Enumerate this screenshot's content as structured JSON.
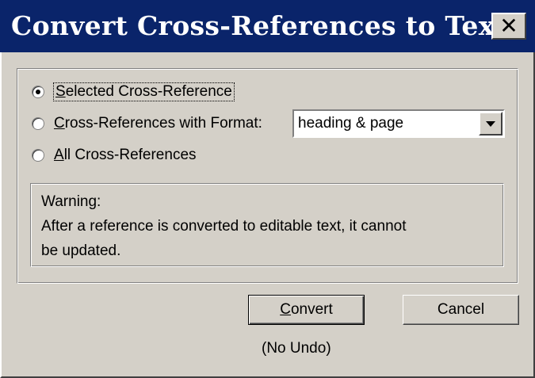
{
  "window": {
    "title": "Convert Cross-References to Text",
    "close_glyph": "✕"
  },
  "options": {
    "selected": {
      "accel": "S",
      "rest": "elected Cross-Reference",
      "checked": true
    },
    "with_format": {
      "accel": "C",
      "rest": "ross-References with Format:",
      "checked": false
    },
    "all": {
      "accel": "A",
      "rest": "ll Cross-References",
      "checked": false
    }
  },
  "format_select": {
    "value": "heading & page"
  },
  "warning": {
    "line1": "Warning:",
    "line2": "After a reference is converted to editable text, it cannot",
    "line3": "be updated."
  },
  "buttons": {
    "convert_accel": "C",
    "convert_rest": "onvert",
    "cancel": "Cancel"
  },
  "footer": {
    "no_undo": "(No Undo)"
  }
}
